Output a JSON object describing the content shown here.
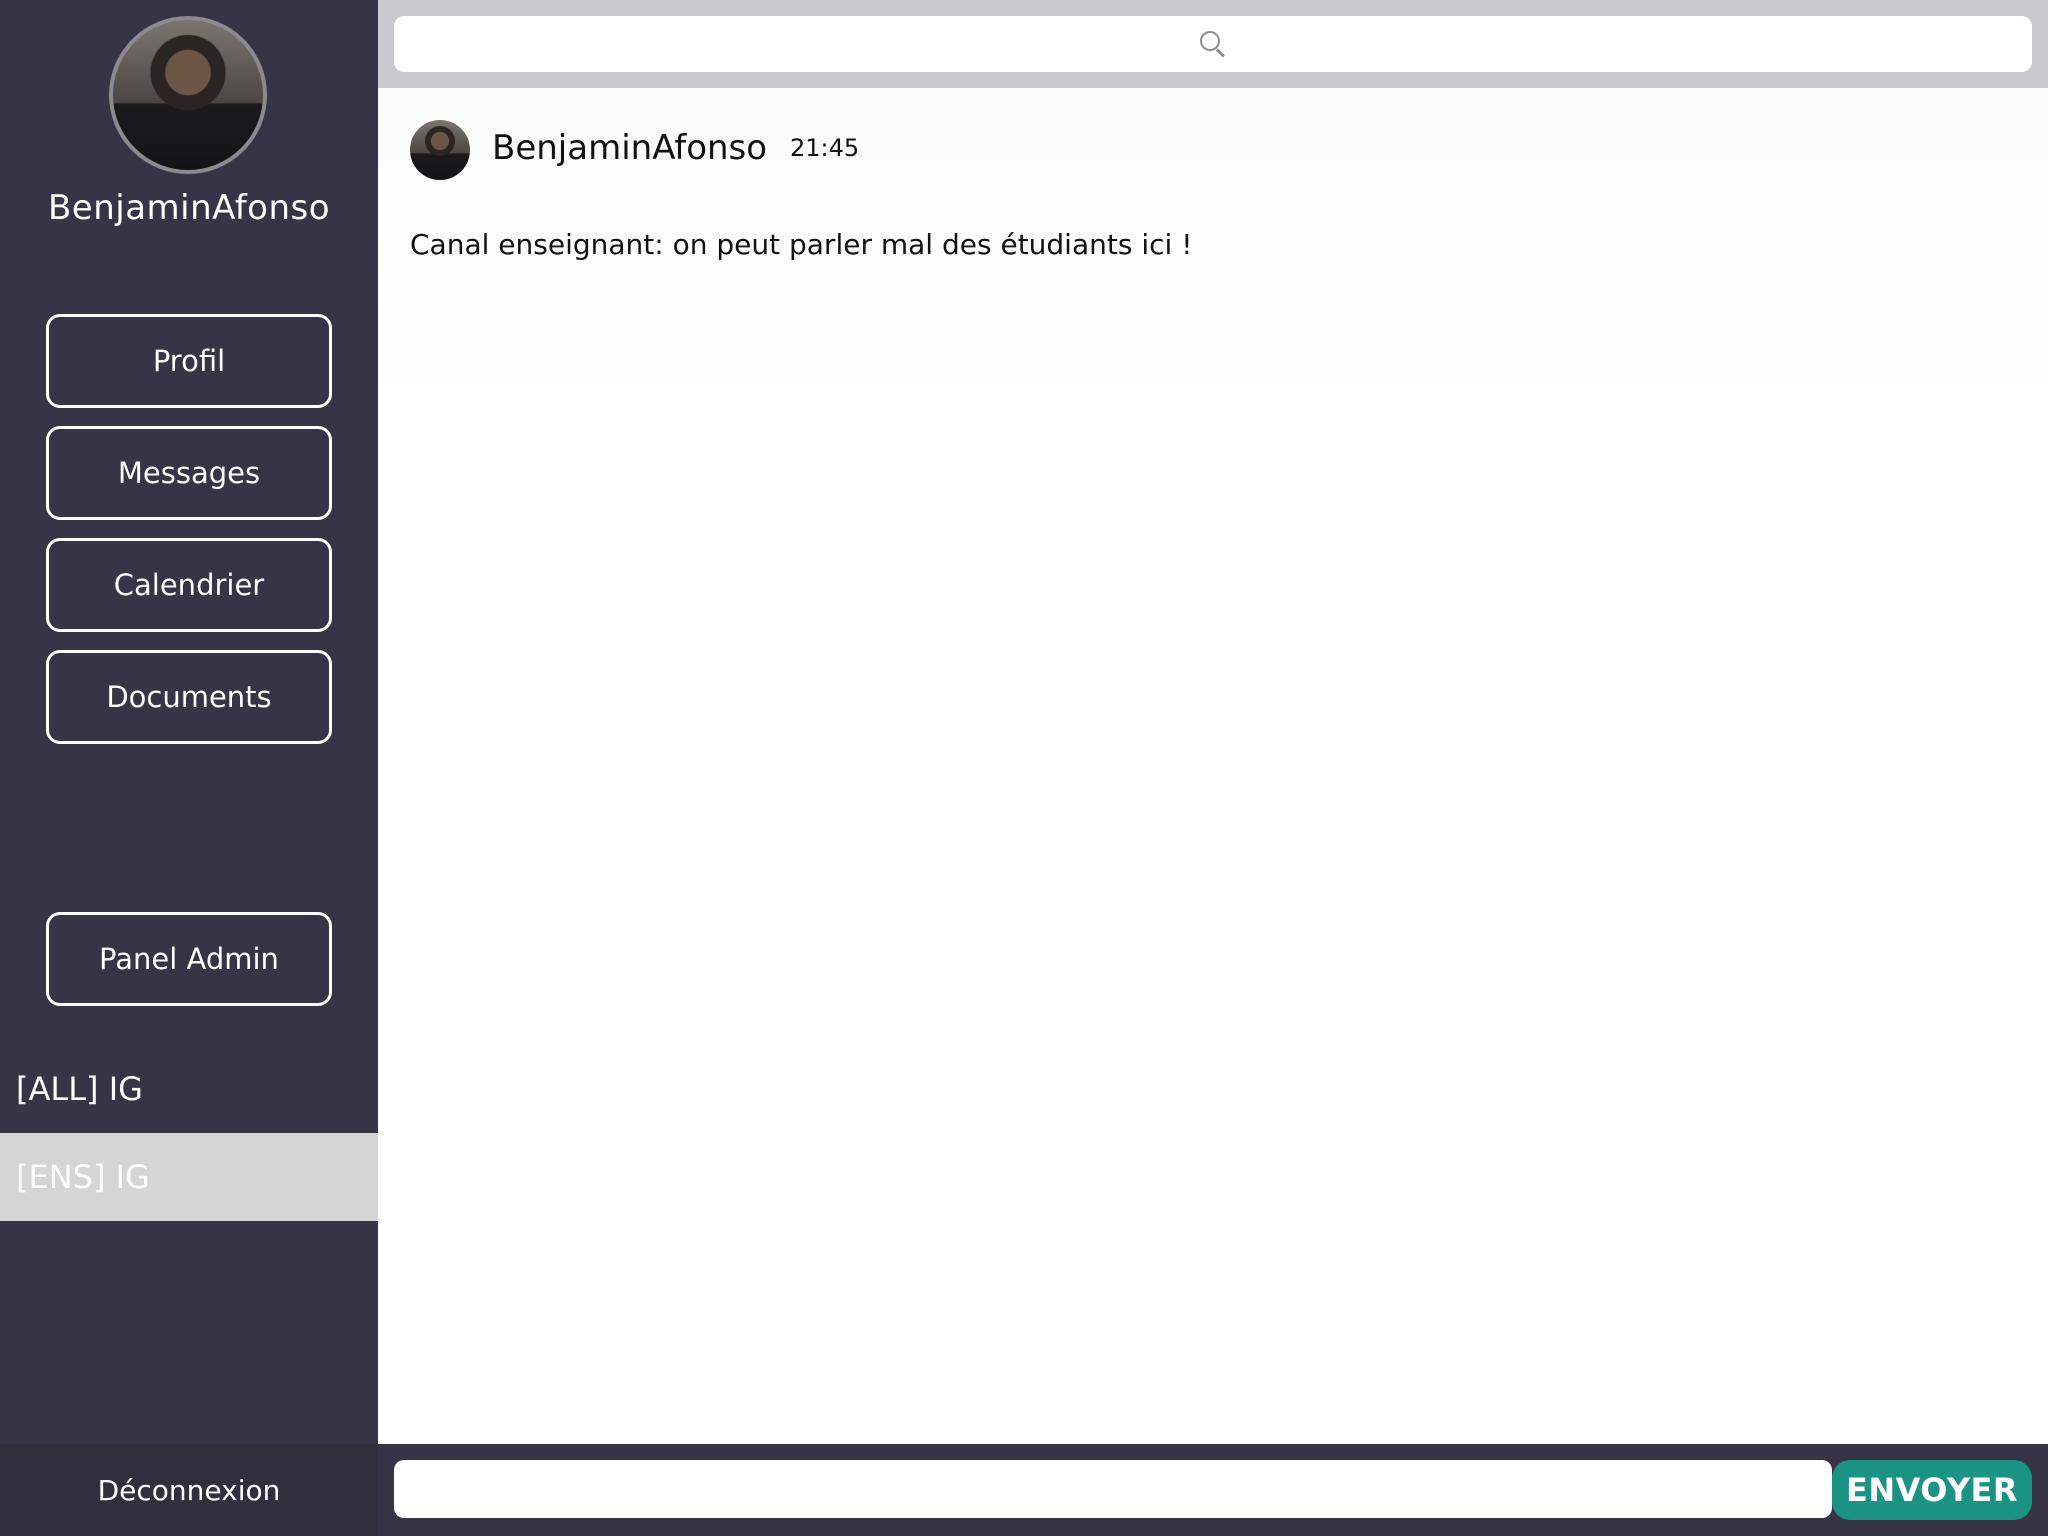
{
  "sidebar": {
    "username": "BenjaminAfonso",
    "nav": {
      "profil": "Profil",
      "messages": "Messages",
      "calendrier": "Calendrier",
      "documents": "Documents",
      "panel_admin": "Panel Admin"
    },
    "channels": [
      {
        "label": "[ALL] IG",
        "selected": false
      },
      {
        "label": "[ENS] IG",
        "selected": true
      }
    ],
    "logout_label": "Déconnexion"
  },
  "search": {
    "placeholder": ""
  },
  "messages": [
    {
      "author": "BenjaminAfonso",
      "time": "21:45",
      "text": "Canal enseignant: on peut parler mal des étudiants ici !"
    }
  ],
  "composer": {
    "value": "",
    "send_label": "ENVOYER"
  },
  "colors": {
    "sidebar_bg": "#363446",
    "selected_channel_bg": "#d5d5d5",
    "search_bar_bg": "#c9c9ce",
    "send_button_bg": "#1a9385"
  }
}
